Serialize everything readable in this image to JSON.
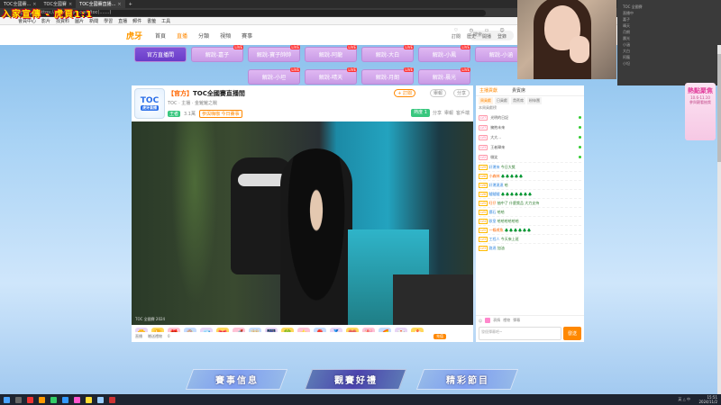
{
  "overlay_text": "入家宣傳 - 虎頁1:1",
  "browser": {
    "tabs": [
      "TOC全國賽...",
      "TOC全國賽",
      "TOC全國賽"
    ],
    "active_tab": "TOC全國賽直播...",
    "url": "https://www.huya.com/toc(.......)",
    "bookmarks": [
      "會員中心",
      "影片",
      "找資料",
      "圖片",
      "新聞",
      "學習",
      "直播",
      "郵件",
      "書籤",
      "工具"
    ]
  },
  "site": {
    "logo": "虎牙",
    "nav": [
      "首頁",
      "直播",
      "分類",
      "視頻",
      "賽事"
    ],
    "nav_active_index": 1,
    "search_placeholder": "搜索",
    "header_icons": [
      "訂閱",
      "歷史",
      "開播",
      "登錄"
    ]
  },
  "categories": [
    {
      "label": "官方直播間",
      "badge": "",
      "primary": true
    },
    {
      "label": "解說-嘉子",
      "badge": "LIVE"
    },
    {
      "label": "解說-寶子帥帥",
      "badge": "LIVE"
    },
    {
      "label": "解說-阿龍",
      "badge": "LIVE"
    },
    {
      "label": "解說-大白",
      "badge": "LIVE"
    },
    {
      "label": "解說-小鳳",
      "badge": "LIVE"
    },
    {
      "label": "解說-小涵",
      "badge": "LIVE"
    },
    {
      "label": "解說-小坦",
      "badge": "LIVE"
    },
    {
      "label": "解說-晴天",
      "badge": "LIVE"
    },
    {
      "label": "解說-月朗",
      "badge": "LIVE"
    },
    {
      "label": "解說-晨光",
      "badge": "LIVE"
    },
    {
      "label": "解說-嘉子",
      "badge": "LIVE"
    }
  ],
  "room": {
    "avatar_text": "TOC",
    "avatar_sub": "虎牙直播",
    "title_tag": "【官方】",
    "title": "TOC全國賽直播間",
    "meta": "TOC · 主播 · 金鏟鏟之戰",
    "meta2_left": "王者",
    "meta2_mid": "3.1萬",
    "meta2_event": "參與嗨咖 今日賽事",
    "follow": "+ 訂閱",
    "report": "舉報",
    "share": "分享",
    "hot_label": "熱度",
    "hot_value": "1",
    "hot_actions": [
      "分享",
      "舉報",
      "客戶端"
    ],
    "video_label": "TOC 全國賽 2024"
  },
  "gifts": [
    "🌼",
    "🏆",
    "🎁",
    "🍭",
    "💎",
    "🎀",
    "🚀",
    "👑",
    "🎆",
    "🍀",
    "⭐",
    "🎈",
    "🏅",
    "💗",
    "🎉",
    "🌈",
    "🎲",
    "🍰"
  ],
  "bottom_row": {
    "left": "直播",
    "mid": "贈送禮物",
    "count": "0",
    "charge": "充值"
  },
  "chat": {
    "tabs": [
      "主播貢獻",
      "貴賓席"
    ],
    "active_tab": 0,
    "rank_tabs": [
      "周貢獻",
      "日貢獻",
      "貴賓席",
      "粉絲團"
    ],
    "rank_active": 0,
    "rank_title": "本周貢獻榜",
    "rank": [
      {
        "lv": "LV7",
        "name": "光明的日記"
      },
      {
        "lv": "LV7",
        "name": "擁抱未來"
      },
      {
        "lv": "LV5",
        "name": "大大..."
      },
      {
        "lv": "LV3",
        "name": "王者歸來"
      },
      {
        "lv": "LV2",
        "name": "微笑"
      }
    ],
    "messages": [
      {
        "lv": "LV9",
        "name": "好運來",
        "text": "今日大獎"
      },
      {
        "lv": "LV8",
        "name": "小森林",
        "text": "🌲🌲🌲🌲🌲"
      },
      {
        "lv": "LV6",
        "name": "好運連連",
        "text": "哈"
      },
      {
        "lv": "LV6",
        "name": "驢驢驢",
        "text": "🌲🌲🌲🌲🌲🌲🌲"
      },
      {
        "lv": "LV5",
        "name": "旺仔",
        "text": "抽中了 什麼獎品 大力支持"
      },
      {
        "lv": "LV5",
        "name": "鑽石",
        "text": "哈哈"
      },
      {
        "lv": "LV4",
        "name": "歐皇",
        "text": "哈哈哈哈哈哈"
      },
      {
        "lv": "LV5",
        "name": "一條咸魚",
        "text": "🌲🌲🌲🌲🌲🌲"
      },
      {
        "lv": "LV3",
        "name": "工程人",
        "text": "今天來上班"
      },
      {
        "lv": "LV3",
        "name": "路過",
        "text": "加油"
      }
    ],
    "input_placeholder": "發個彈幕吧~",
    "send_label": "發送",
    "tools": [
      "表情",
      "禮物",
      "彈幕"
    ]
  },
  "bottom_buttons": [
    "賽事信息",
    "觀賽好禮",
    "精彩節目"
  ],
  "promo": {
    "title": "熱點聚焦",
    "line1": "10.6-11.10",
    "line2": "參與觀看抽獎"
  },
  "sidebar_lines": [
    "TOC 全國賽",
    "直播中",
    "嘉子",
    "晴天",
    "月朗",
    "晨光",
    "小涵",
    "大白",
    "阿龍",
    "小坦"
  ],
  "taskbar": {
    "time": "15:51",
    "date": "2024/11/2",
    "sys": "英 △ 中"
  }
}
